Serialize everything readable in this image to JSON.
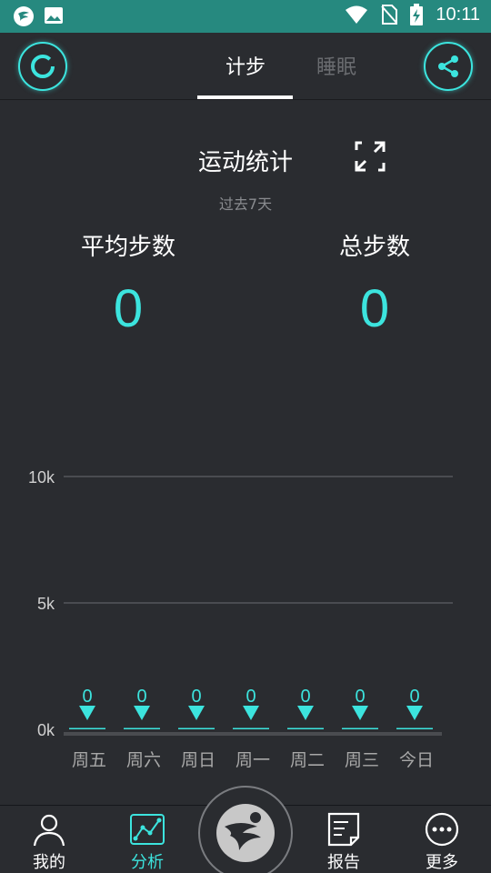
{
  "status_bar": {
    "time": "10:11"
  },
  "header": {
    "tabs": [
      {
        "label": "计步",
        "active": true
      },
      {
        "label": "睡眠",
        "active": false
      }
    ]
  },
  "stats": {
    "title": "运动统计",
    "subtitle": "过去7天",
    "avg_label": "平均步数",
    "avg_value": "0",
    "total_label": "总步数",
    "total_value": "0"
  },
  "chart_data": {
    "type": "bar",
    "categories": [
      "周五",
      "周六",
      "周日",
      "周一",
      "周二",
      "周三",
      "今日"
    ],
    "values": [
      0,
      0,
      0,
      0,
      0,
      0,
      0
    ],
    "yticks": [
      "10k",
      "5k",
      "0k"
    ],
    "ytick_values": [
      10000,
      5000,
      0
    ],
    "ylim": [
      0,
      10000
    ],
    "grid": true,
    "accent_color": "#3ce4de"
  },
  "nav": {
    "items": [
      {
        "label": "我的",
        "icon": "user-icon",
        "active": false
      },
      {
        "label": "分析",
        "icon": "chart-icon",
        "active": true
      },
      {
        "label": "报告",
        "icon": "report-icon",
        "active": false
      },
      {
        "label": "更多",
        "icon": "more-icon",
        "active": false
      }
    ],
    "center_icon": "runner-logo-icon"
  },
  "colors": {
    "accent": "#3ce4de",
    "status_bar": "#26897f",
    "background": "#2a2c30"
  }
}
